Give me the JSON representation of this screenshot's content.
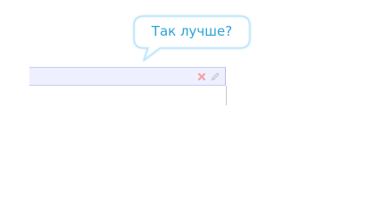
{
  "tooltip": {
    "text": "Так лучше?"
  },
  "panel": {
    "actions": [
      {
        "icon": "close-icon",
        "color": "#f3a2a2"
      },
      {
        "icon": "pencil-icon",
        "color": "#c7c7c7"
      }
    ]
  },
  "colors": {
    "tooltip_text": "#2fa3d6",
    "tooltip_border": "#9fd7f5",
    "panel_bg": "#eef0ff",
    "panel_border": "#c9ccf0"
  }
}
